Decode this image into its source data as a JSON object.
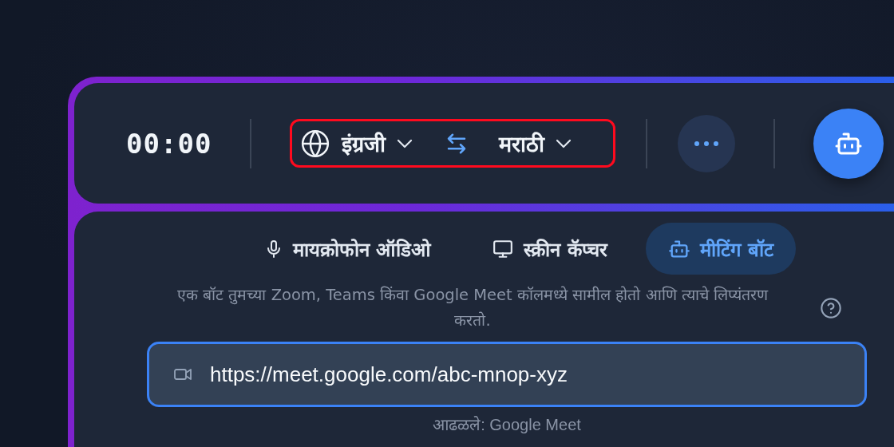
{
  "timer": "00:00",
  "language_selector": {
    "source": "इंग्रजी",
    "target": "मराठी",
    "highlighted": true
  },
  "tabs": [
    {
      "kind": "microphone",
      "label": "मायक्रोफोन ऑडिओ",
      "selected": false
    },
    {
      "kind": "screen",
      "label": "स्क्रीन कॅप्चर",
      "selected": false
    },
    {
      "kind": "bot",
      "label": "मीटिंग बॉट",
      "selected": true
    }
  ],
  "description": "एक बॉट तुमच्या Zoom, Teams किंवा Google Meet कॉलमध्ये सामील होतो आणि त्याचे लिप्यंतरण करतो.",
  "url_field": {
    "value": "https://meet.google.com/abc-mnop-xyz"
  },
  "detected": "आढळले: Google Meet"
}
